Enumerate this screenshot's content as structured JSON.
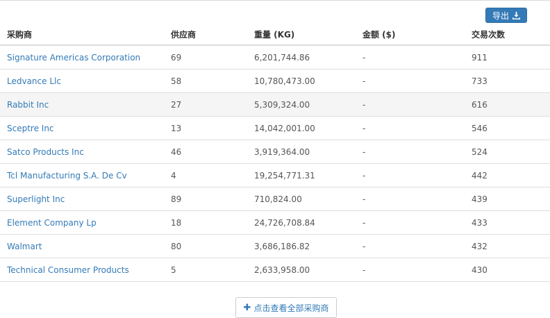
{
  "toolbar": {
    "export_label": "导出"
  },
  "table": {
    "headers": [
      "采购商",
      "供应商",
      "重量 (KG)",
      "金额 ($)",
      "交易次数"
    ],
    "rows": [
      {
        "buyer": "Signature Americas Corporation",
        "suppliers": "69",
        "weight": "6,201,744.86",
        "amount": "-",
        "trades": "911"
      },
      {
        "buyer": "Ledvance Llc",
        "suppliers": "58",
        "weight": "10,780,473.00",
        "amount": "-",
        "trades": "733"
      },
      {
        "buyer": "Rabbit Inc",
        "suppliers": "27",
        "weight": "5,309,324.00",
        "amount": "-",
        "trades": "616"
      },
      {
        "buyer": "Sceptre Inc",
        "suppliers": "13",
        "weight": "14,042,001.00",
        "amount": "-",
        "trades": "546"
      },
      {
        "buyer": "Satco Products Inc",
        "suppliers": "46",
        "weight": "3,919,364.00",
        "amount": "-",
        "trades": "524"
      },
      {
        "buyer": "Tcl Manufacturing S.A. De Cv",
        "suppliers": "4",
        "weight": "19,254,771.31",
        "amount": "-",
        "trades": "442"
      },
      {
        "buyer": "Superlight Inc",
        "suppliers": "89",
        "weight": "710,824.00",
        "amount": "-",
        "trades": "439"
      },
      {
        "buyer": "Element Company Lp",
        "suppliers": "18",
        "weight": "24,726,708.84",
        "amount": "-",
        "trades": "433"
      },
      {
        "buyer": "Walmart",
        "suppliers": "80",
        "weight": "3,686,186.82",
        "amount": "-",
        "trades": "432"
      },
      {
        "buyer": "Technical Consumer Products",
        "suppliers": "5",
        "weight": "2,633,958.00",
        "amount": "-",
        "trades": "430"
      }
    ]
  },
  "footer": {
    "view_all_label": "点击查看全部采购商"
  }
}
